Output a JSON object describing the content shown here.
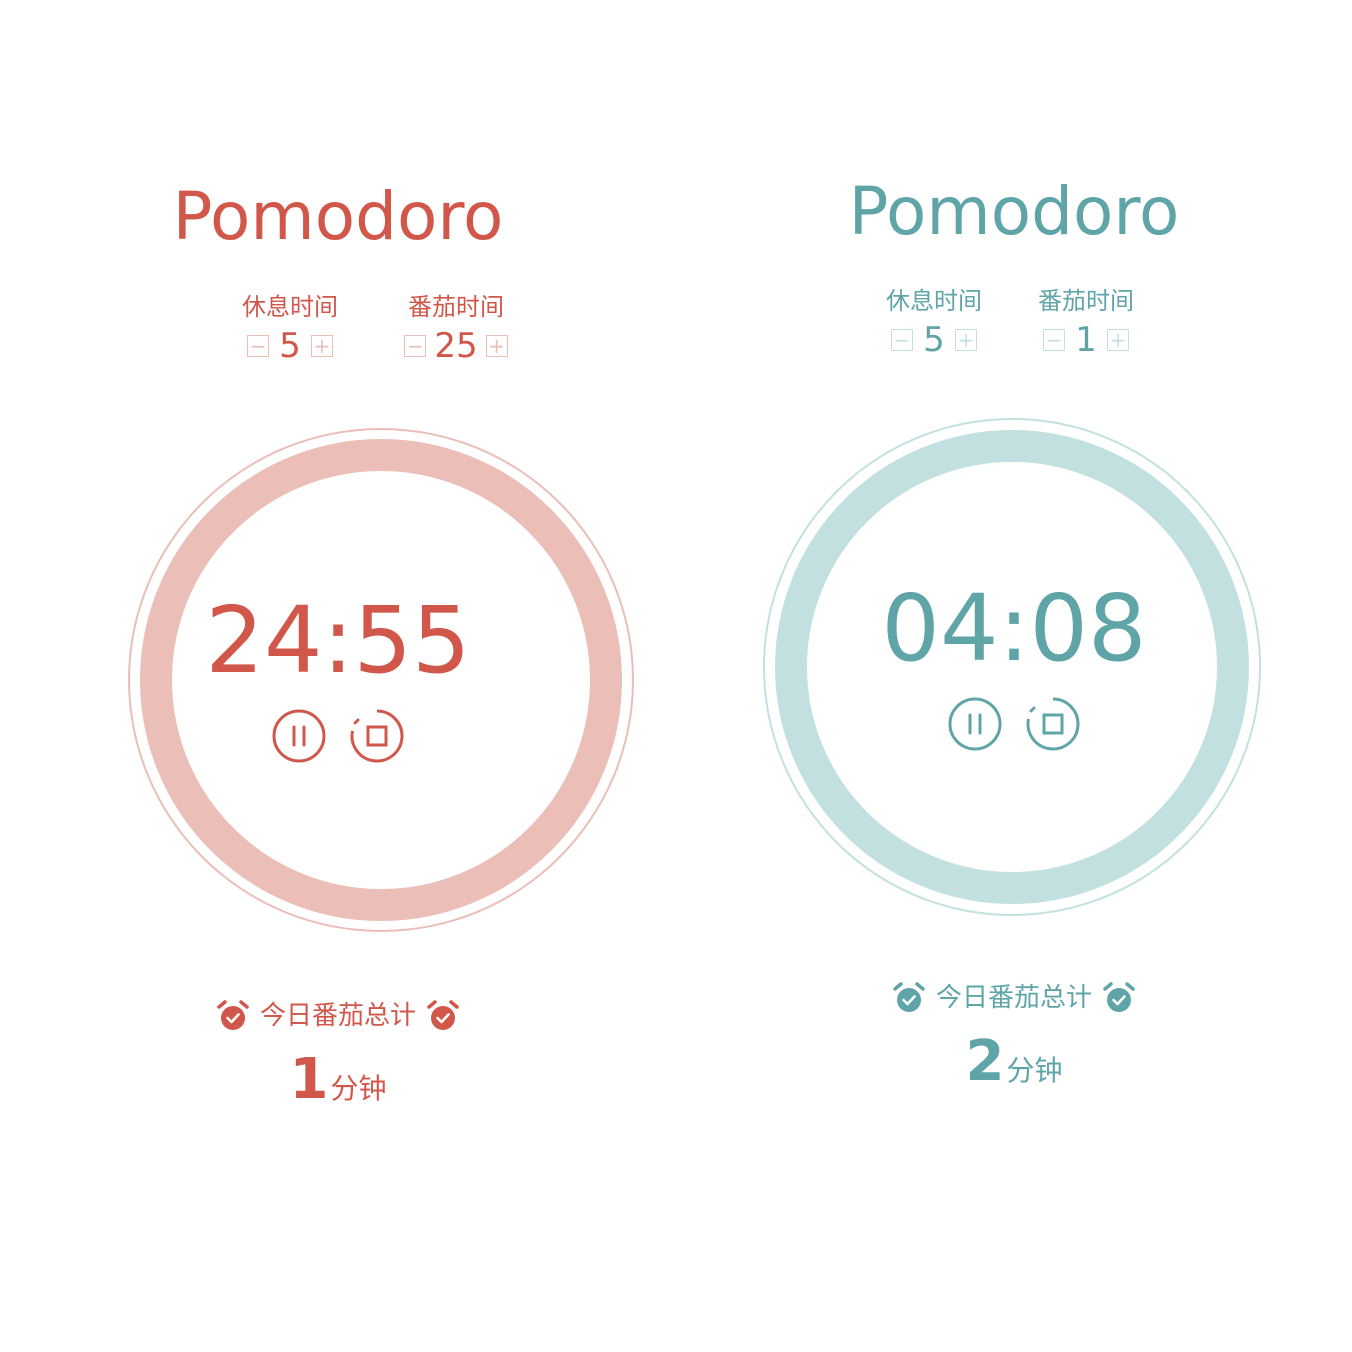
{
  "colors": {
    "red": "#d2574b",
    "red_light": "#ebbeb8",
    "teal": "#5fa5a8",
    "teal_light": "#c3e0e1"
  },
  "panels": [
    {
      "theme": "red",
      "title": "Pomodoro",
      "rest": {
        "label": "休息时间",
        "value": "5"
      },
      "work": {
        "label": "番茄时间",
        "value": "25"
      },
      "timer": "24:55",
      "summary_label": "今日番茄总计",
      "total_value": "1",
      "total_unit": "分钟"
    },
    {
      "theme": "teal",
      "title": "Pomodoro",
      "rest": {
        "label": "休息时间",
        "value": "5"
      },
      "work": {
        "label": "番茄时间",
        "value": "1"
      },
      "timer": "04:08",
      "summary_label": "今日番茄总计",
      "total_value": "2",
      "total_unit": "分钟"
    }
  ],
  "icons": {
    "decrement": "minus-square-icon",
    "increment": "plus-square-icon",
    "pause": "pause-circle-icon",
    "stop": "stop-circle-icon",
    "alarm": "alarm-clock-check-icon"
  }
}
